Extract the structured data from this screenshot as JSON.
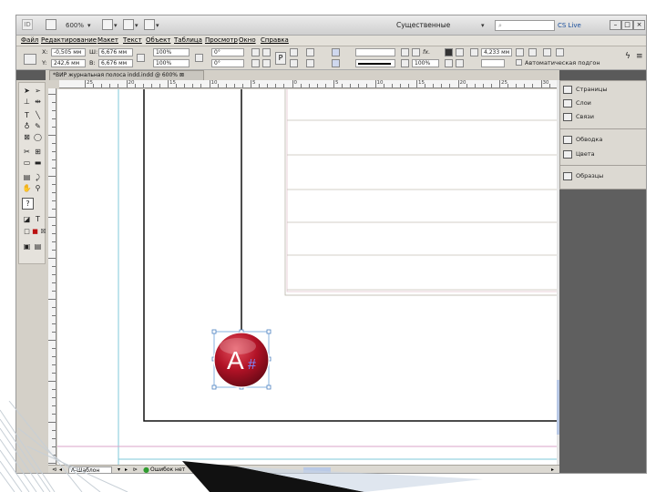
{
  "titlebar": {
    "logo_text": "ID",
    "zoom": "600%",
    "workspace": "Существенные элементы",
    "search_placeholder": "",
    "cs_live": "CS Live"
  },
  "menu": [
    "Файл",
    "Редактирование",
    "Макет",
    "Текст",
    "Объект",
    "Таблица",
    "Просмотр",
    "Окно",
    "Справка"
  ],
  "control": {
    "x_label": "X:",
    "x_value": "-0,505 мм",
    "y_label": "Y:",
    "y_value": "242,6 мм",
    "w_label": "Ш:",
    "w_value": "6,676 мм",
    "h_label": "В:",
    "h_value": "6,676 мм",
    "scale_x": "100%",
    "scale_y": "100%",
    "rotate": "0°",
    "shear": "0°",
    "stroke_weight": "",
    "opacity": "100%",
    "gap": "4,233 мм",
    "autofit": "Автоматическая подгон"
  },
  "document_tab": "*ВИР журнальная полоса indd.indd @ 600%",
  "rulers": {
    "h_numbers": [
      "25",
      "20",
      "15",
      "10",
      "5",
      "0",
      "5",
      "10",
      "15",
      "20",
      "25",
      "30"
    ]
  },
  "status": {
    "page": "A-Шаблон",
    "errors": "Ошибок нет"
  },
  "panels": [
    {
      "label": "Страницы",
      "icon": "pages-icon"
    },
    {
      "label": "Слои",
      "icon": "layers-icon"
    },
    {
      "label": "Связи",
      "icon": "links-icon"
    },
    {
      "label": "Обводка",
      "icon": "stroke-icon"
    },
    {
      "label": "Цвета",
      "icon": "swatches-icon"
    },
    {
      "label": "Образцы",
      "icon": "samples-icon"
    }
  ],
  "badge": {
    "text": "A",
    "symbol": "#",
    "color": "#b11226"
  }
}
